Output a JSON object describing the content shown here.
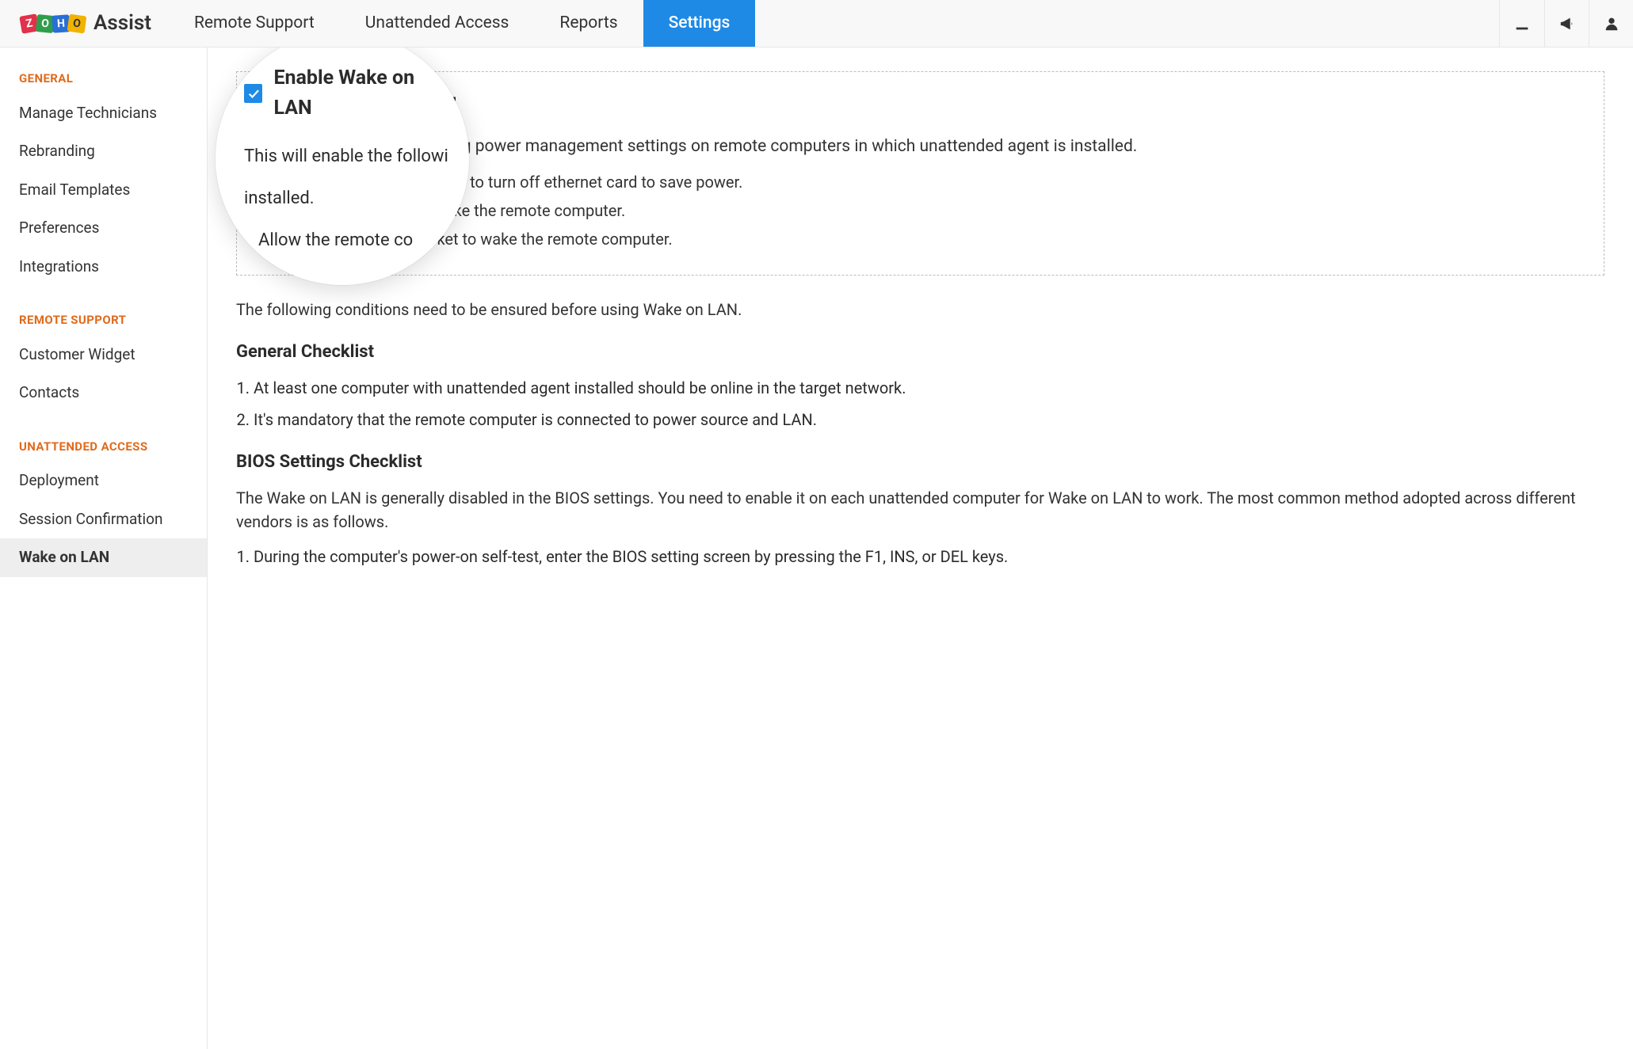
{
  "brand": {
    "name": "Assist"
  },
  "nav": {
    "items": [
      {
        "label": "Remote Support"
      },
      {
        "label": "Unattended Access"
      },
      {
        "label": "Reports"
      },
      {
        "label": "Settings"
      }
    ],
    "activeIndex": 3
  },
  "sidebar": {
    "groups": [
      {
        "title": "GENERAL",
        "items": [
          {
            "label": "Manage Technicians"
          },
          {
            "label": "Rebranding"
          },
          {
            "label": "Email Templates"
          },
          {
            "label": "Preferences"
          },
          {
            "label": "Integrations"
          }
        ]
      },
      {
        "title": "REMOTE SUPPORT",
        "items": [
          {
            "label": "Customer Widget"
          },
          {
            "label": "Contacts"
          }
        ]
      },
      {
        "title": "UNATTENDED ACCESS",
        "items": [
          {
            "label": "Deployment"
          },
          {
            "label": "Session Confirmation"
          },
          {
            "label": "Wake on LAN",
            "active": true
          }
        ]
      }
    ]
  },
  "main": {
    "enable_checkbox_label": "Enable Wake on LAN",
    "enable_description": "This will enable the following power management settings on remote computers in which unattended agent is installed.",
    "enable_list": [
      "Allow the remote computer to turn off ethernet card to save power.",
      "Allow ethernet card to wake the remote computer.",
      "Only allow a magic packet to wake the remote computer."
    ],
    "conditions_intro": "The following conditions need to be ensured before using Wake on LAN.",
    "general_checklist_title": "General Checklist",
    "general_checklist": [
      "At least one computer with unattended agent installed should be online in the target network.",
      "It's mandatory that the remote computer is connected to power source and LAN."
    ],
    "bios_title": "BIOS Settings Checklist",
    "bios_intro": "The Wake on LAN is generally disabled in the BIOS settings. You need to enable it on each unattended computer for Wake on LAN to work. The most common method adopted across different vendors is as follows.",
    "bios_list": [
      "During the computer's power-on self-test, enter the BIOS setting screen by pressing the F1, INS, or DEL keys."
    ]
  },
  "magnifier": {
    "label": "Enable Wake on LAN",
    "para": "This will enable the followi",
    "item": "Allow the remote co"
  }
}
